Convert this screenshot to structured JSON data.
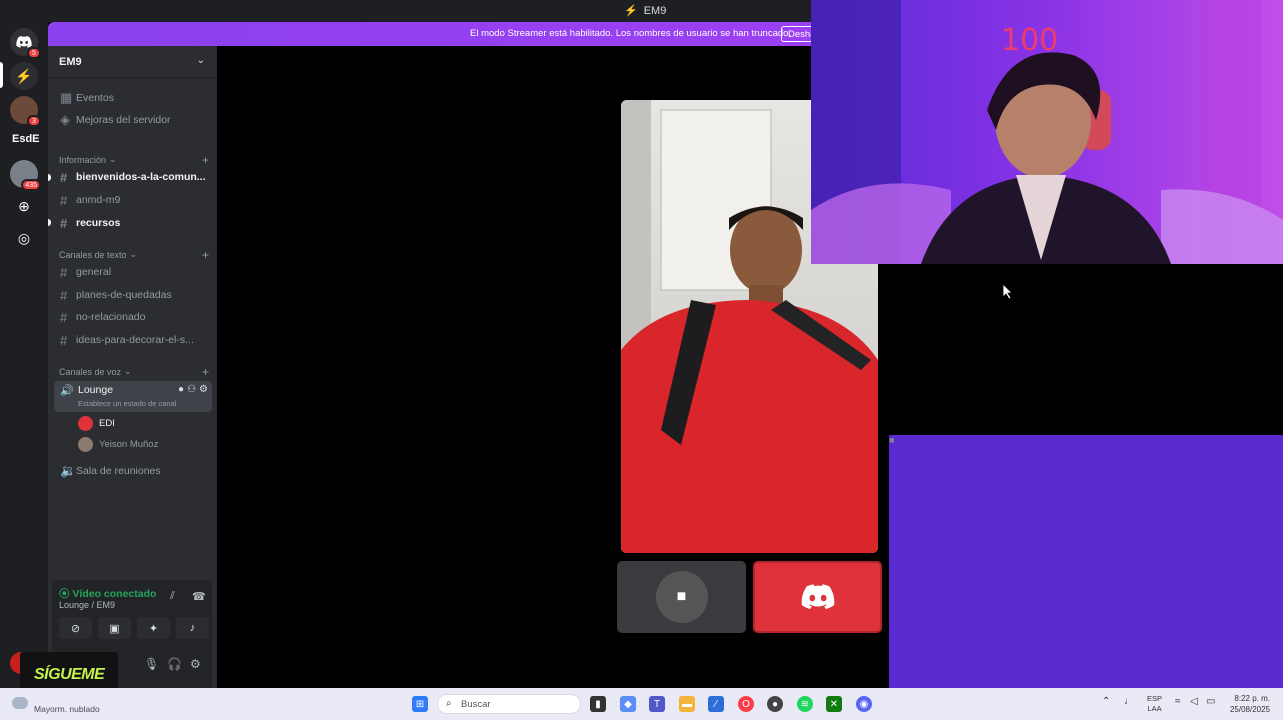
{
  "window": {
    "title": "EM9"
  },
  "banner": {
    "message": "El modo Streamer está habilitado. Los nombres de usuario se han truncado.",
    "button": "Deshabilitar"
  },
  "rail": {
    "servers": [
      {
        "name": "discord-home",
        "badge": "5"
      },
      {
        "name": "server-2",
        "badge": ""
      },
      {
        "name": "server-3",
        "badge": "3"
      },
      {
        "name": "EsdE",
        "badge": ""
      },
      {
        "name": "server-5",
        "badge": "435"
      }
    ]
  },
  "guild": {
    "name": "EM9",
    "top_items": [
      {
        "icon": "calendar-icon",
        "label": "Eventos"
      },
      {
        "icon": "boost-icon",
        "label": "Mejoras del servidor"
      }
    ],
    "categories": [
      {
        "name": "Información",
        "channels": [
          {
            "name": "bienvenidos-a-la-comun...",
            "unread": true
          },
          {
            "name": "anmd-m9",
            "unread": false
          },
          {
            "name": "recursos",
            "unread": true
          }
        ]
      },
      {
        "name": "Canales de texto",
        "channels": [
          {
            "name": "general",
            "unread": false
          },
          {
            "name": "planes-de-quedadas",
            "unread": false
          },
          {
            "name": "no-relacionado",
            "unread": false
          },
          {
            "name": "ideas-para-decorar-el-s...",
            "unread": false
          }
        ]
      },
      {
        "name": "Canales de voz"
      }
    ],
    "voice": {
      "active_channel": "Lounge",
      "status_hint": "Establece un estado de canal",
      "members": [
        "EDI",
        "Yeison Muñoz"
      ],
      "other_channel": "Sala de reuniones"
    }
  },
  "voice_panel": {
    "status": "Vídeo conectado",
    "location": "Lounge / EM9"
  },
  "overlay": {
    "follow_text": "SÍGUEME"
  },
  "taskbar": {
    "weather": "Mayorm. nublado",
    "search_placeholder": "Buscar",
    "language_top": "ESP",
    "language_bottom": "LAA",
    "time": "8:22 p. m.",
    "date": "25/08/2025"
  },
  "colors": {
    "accent": "#5865f2",
    "banner": "#9c3ff2",
    "connected": "#23a55a",
    "red_tile": "#e0323a"
  }
}
